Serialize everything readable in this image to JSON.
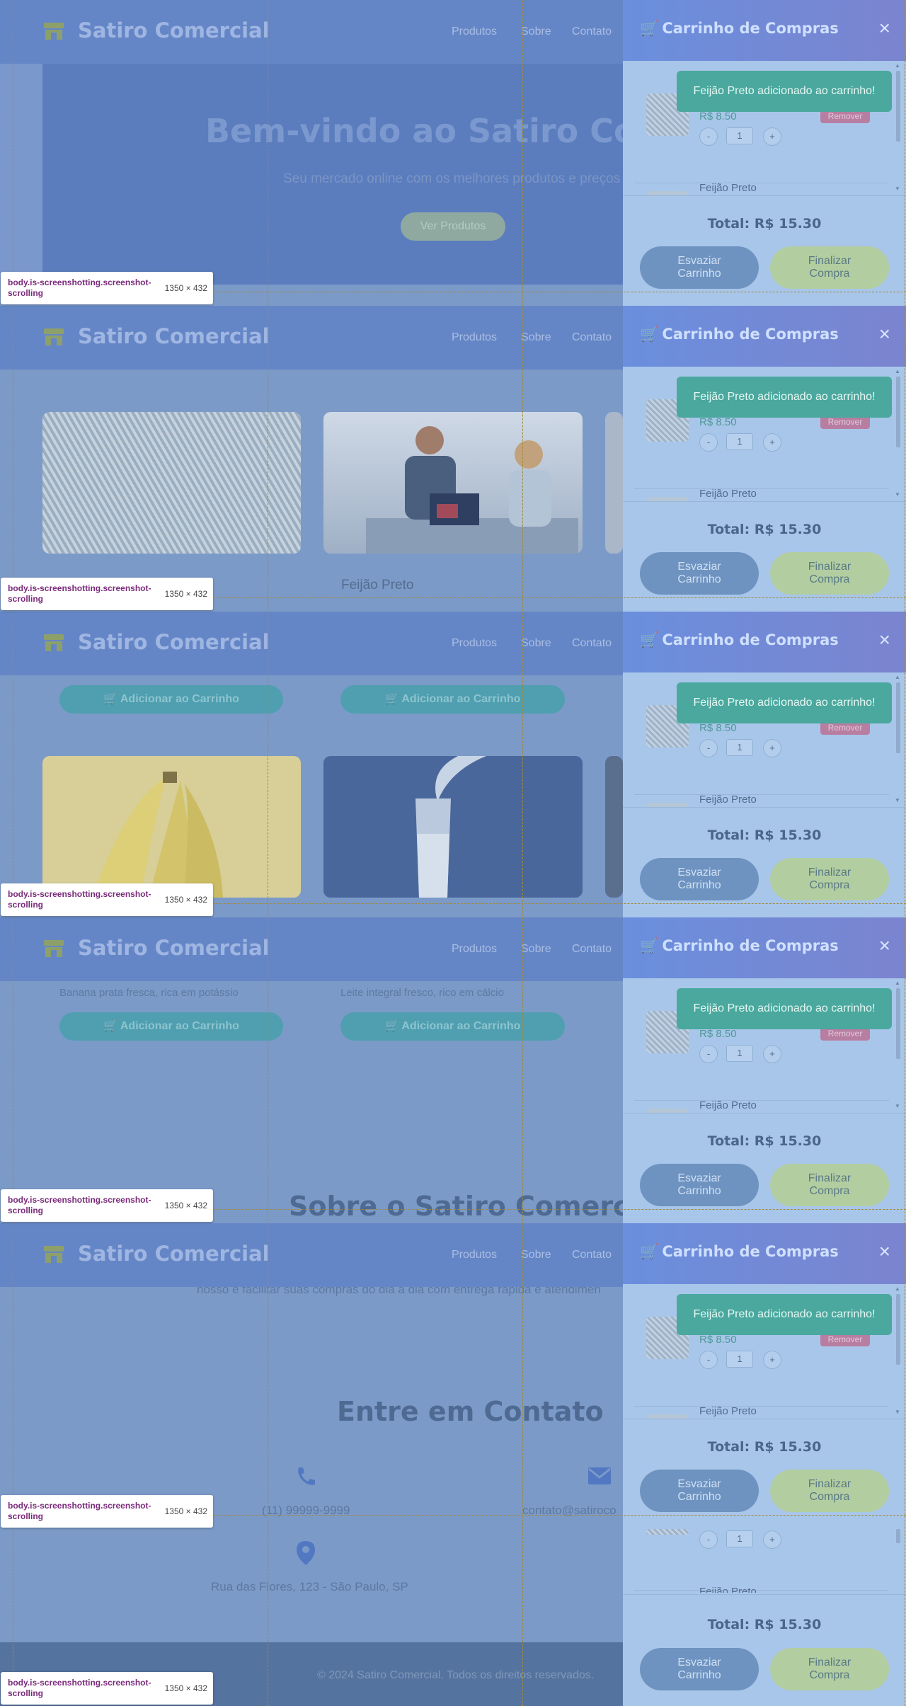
{
  "header": {
    "brand": "Satiro Comercial",
    "nav": [
      "Produtos",
      "Sobre",
      "Contato"
    ]
  },
  "hero": {
    "title": "Bem-vindo ao Satiro Come",
    "subtitle": "Seu mercado online com os melhores produtos e preços",
    "button": "Ver Produtos"
  },
  "products": {
    "card1_title": "Feijão Preto",
    "add_label": "Adicionar ao Carrinho",
    "banana_desc": "Banana prata fresca, rica em potássio",
    "leite_desc": "Leite integral fresco, rico em cálcio"
  },
  "sobre": {
    "title": "Sobre o Satiro Comercial",
    "text": "nosso é facilitar suas compras do dia a dia com entrega rápida e atendimen"
  },
  "contato": {
    "title": "Entre em Contato",
    "phone": "(11) 99999-9999",
    "email": "contato@satiroco",
    "address": "Rua das Flores, 123 - São Paulo, SP"
  },
  "footer": {
    "text": "© 2024 Satiro Comercial. Todos os direitos reservados."
  },
  "cart": {
    "title": "Carrinho de Compras",
    "close": "×",
    "toast": "Feijão Preto adicionado ao carrinho!",
    "item_price": "R$ 8.50",
    "remove": "Remover",
    "qty_minus": "-",
    "qty_value": "1",
    "qty_plus": "+",
    "next_item": "Feijão Preto",
    "total": "Total: R$ 15.30",
    "empty_btn": "Esvaziar Carrinho",
    "checkout_btn": "Finalizar Compra"
  },
  "screenshot_label": {
    "selector": "body.is-screenshotting.screenshot-scrolling",
    "dims": "1350 × 432"
  },
  "colors": {
    "toast": "#4aa89e",
    "remove": "#b77ea2",
    "add_button": "#4f9fb0",
    "cart_header": "#6a8fdd"
  }
}
